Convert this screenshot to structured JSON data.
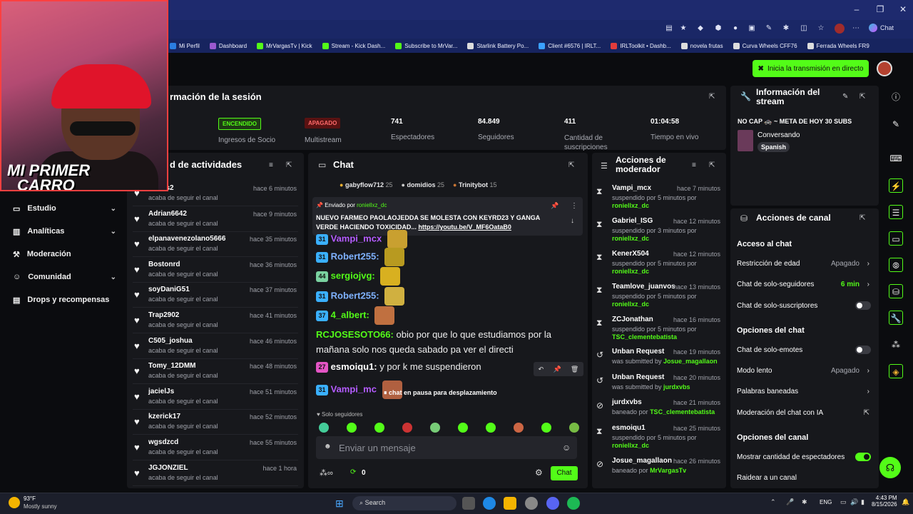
{
  "browser": {
    "bookmarks": [
      {
        "label": "Mi Perfil",
        "color": "#2a7de1"
      },
      {
        "label": "Dashboard",
        "color": "#9b59d0"
      },
      {
        "label": "MrVargasTv | Kick",
        "color": "#53fc18"
      },
      {
        "label": "Stream - Kick Dash...",
        "color": "#53fc18"
      },
      {
        "label": "Subscribe to MrVar...",
        "color": "#53fc18"
      },
      {
        "label": "Starlink Battery Po...",
        "color": "#dddddd"
      },
      {
        "label": "Client #6576 | IRLT...",
        "color": "#3aa0ff"
      },
      {
        "label": "IRLToolkit • Dashb...",
        "color": "#e23c3c"
      },
      {
        "label": "novela frutas",
        "color": "#dddddd"
      },
      {
        "label": "Curva Wheels CFF76",
        "color": "#dddddd"
      },
      {
        "label": "Ferrada Wheels FR9",
        "color": "#dddddd"
      }
    ],
    "copilot_label": "Chat"
  },
  "webcam": {
    "overlay_text_line1": "MI PRIMER",
    "overlay_text_line2": "CARRO"
  },
  "header": {
    "go_live_label": "Inicia la transmisión en directo"
  },
  "sidebar": {
    "items": [
      {
        "label": "Estudio",
        "icon": "studio-icon",
        "has_chevron": true
      },
      {
        "label": "Analíticas",
        "icon": "analytics-icon",
        "has_chevron": true
      },
      {
        "label": "Moderación",
        "icon": "moderation-icon",
        "has_chevron": false
      },
      {
        "label": "Comunidad",
        "icon": "community-icon",
        "has_chevron": true
      },
      {
        "label": "Drops y recompensas",
        "icon": "drops-icon",
        "has_chevron": false
      }
    ]
  },
  "session": {
    "title": "rmación de la sesión",
    "stats": [
      {
        "badge": "ENCENDIDO",
        "label": "Ingresos de Socio"
      },
      {
        "badge": "APAGADO",
        "label": "Multistream"
      },
      {
        "value": "741",
        "label": "Espectadores"
      },
      {
        "value": "84.849",
        "label": "Seguidores"
      },
      {
        "value": "411",
        "label": "Cantidad de suscripciones"
      },
      {
        "value": "01:04:58",
        "label": "Tiempo en vivo"
      }
    ]
  },
  "stream_info": {
    "title": "Información del stream",
    "stream_title": "NO CAP 🚓 ~ META DE HOY 30 SUBS",
    "category": "Conversando",
    "language": "Spanish"
  },
  "activity": {
    "title": "d de actividades",
    "rows": [
      {
        "name": "ramos2",
        "sub": "acaba de seguir el canal",
        "time": "hace 6 minutos"
      },
      {
        "name": "Adrian6642",
        "sub": "acaba de seguir el canal",
        "time": "hace 9 minutos"
      },
      {
        "name": "elpanavenezolano5666",
        "sub": "acaba de seguir el canal",
        "time": "hace 35 minutos"
      },
      {
        "name": "Bostonrd",
        "sub": "acaba de seguir el canal",
        "time": "hace 36 minutos"
      },
      {
        "name": "soyDaniG51",
        "sub": "acaba de seguir el canal",
        "time": "hace 37 minutos"
      },
      {
        "name": "Trap2902",
        "sub": "acaba de seguir el canal",
        "time": "hace 41 minutos"
      },
      {
        "name": "C505_joshua",
        "sub": "acaba de seguir el canal",
        "time": "hace 46 minutos"
      },
      {
        "name": "Tomy_12DMM",
        "sub": "acaba de seguir el canal",
        "time": "hace 48 minutos"
      },
      {
        "name": "jacielJs",
        "sub": "acaba de seguir el canal",
        "time": "hace 51 minutos"
      },
      {
        "name": "kzerick17",
        "sub": "acaba de seguir el canal",
        "time": "hace 52 minutos"
      },
      {
        "name": "wgsdzcd",
        "sub": "acaba de seguir el canal",
        "time": "hace 55 minutos"
      },
      {
        "name": "JGJONZIEL",
        "sub": "acaba de seguir el canal",
        "time": "hace 1 hora"
      }
    ]
  },
  "chat": {
    "title": "Chat",
    "top_gifters": [
      {
        "name": "gabyflow712",
        "count": "25"
      },
      {
        "name": "domidios",
        "count": "25"
      },
      {
        "name": "Trinitybot",
        "count": "15"
      }
    ],
    "pinned": {
      "by_prefix": "Enviado por",
      "by_user": "roniellxz_dc",
      "text": "NUEVO FARMEO PAOLAOJEDDA SE MOLESTA CON KEYRD23 Y GANGA VERDE HACIENDO TOXICIDAD...",
      "link": "https://youtu.be/V_MF6OataB0"
    },
    "messages": [
      {
        "level": "31",
        "user": "Vampi_mcx",
        "text": "",
        "color": "#b55cff"
      },
      {
        "level": "31",
        "user": "Robert255:",
        "text": "",
        "color": "#7fb2ff"
      },
      {
        "level": "44",
        "user": "sergiojvg:",
        "text": "",
        "color": "#53fc18"
      },
      {
        "level": "31",
        "user": "Robert255:",
        "text": "",
        "color": "#7fb2ff"
      },
      {
        "level": "37",
        "user": "4_albert:",
        "text": "",
        "color": "#53fc18"
      },
      {
        "level": "",
        "user": "RCJOSESOTO66:",
        "text": "obio por que lo que estudiamos por la mañana solo nos queda sabado pa ver el directi",
        "color": "#53fc18"
      },
      {
        "level": "27",
        "user": "esmoiqu1:",
        "text": "y por k me suspendieron",
        "color": "#ffffff"
      },
      {
        "level": "31",
        "user": "Vampi_mc",
        "text": "",
        "color": "#b55cff"
      }
    ],
    "paused_label": "chat en pausa para desplazamiento",
    "followers_only_label": "Solo seguidores",
    "input_placeholder": "Enviar un mensaje",
    "points": "0",
    "send_label": "Chat"
  },
  "mod_actions": {
    "title": "Acciones de moderador",
    "rows": [
      {
        "icon": "timeout-icon",
        "name": "Vampi_mcx",
        "time": "hace 7 minutos",
        "sub": "suspendido por 5 minutos por",
        "by": "roniellxz_dc"
      },
      {
        "icon": "timeout-icon",
        "name": "Gabriel_ISG",
        "time": "hace 12 minutos",
        "sub": "suspendido por 3 minutos por",
        "by": "roniellxz_dc"
      },
      {
        "icon": "timeout-icon",
        "name": "KenerX504",
        "time": "hace 12 minutos",
        "sub": "suspendido por 5 minutos por",
        "by": "roniellxz_dc"
      },
      {
        "icon": "timeout-icon",
        "name": "Teamlove_juanvos",
        "time": "hace 13 minutos",
        "sub": "suspendido por 5 minutos por",
        "by": "roniellxz_dc"
      },
      {
        "icon": "timeout-icon",
        "name": "ZCJonathan",
        "time": "hace 16 minutos",
        "sub": "suspendido por 5 minutos por",
        "by": "TSC_clementebatista"
      },
      {
        "icon": "unban-icon",
        "name": "Unban Request",
        "time": "hace 19 minutos",
        "sub": "was submitted by",
        "by": "Josue_magallaon"
      },
      {
        "icon": "unban-icon",
        "name": "Unban Request",
        "time": "hace 20 minutos",
        "sub": "was submitted by",
        "by": "jurdxvbs"
      },
      {
        "icon": "ban-icon",
        "name": "jurdxvbs",
        "time": "hace 21 minutos",
        "sub": "baneado por",
        "by": "TSC_clementebatista"
      },
      {
        "icon": "timeout-icon",
        "name": "esmoiqu1",
        "time": "hace 25 minutos",
        "sub": "suspendido por 5 minutos por",
        "by": "roniellxz_dc"
      },
      {
        "icon": "ban-icon",
        "name": "Josue_magallaon",
        "time": "hace 26 minutos",
        "sub": "baneado por",
        "by": "MrVargasTv"
      }
    ]
  },
  "channel_actions": {
    "title": "Acciones de canal",
    "chat_access_heading": "Acceso al chat",
    "chat_options_heading": "Opciones del chat",
    "channel_options_heading": "Opciones del canal",
    "rows": [
      {
        "label": "Restricción de edad",
        "value": "Apagado",
        "type": "chevron"
      },
      {
        "label": "Chat de solo-seguidores",
        "value": "6 min",
        "type": "chevron"
      },
      {
        "label": "Chat de solo-suscriptores",
        "value": "",
        "type": "toggle-off"
      },
      {
        "label": "Chat de solo-emotes",
        "value": "",
        "type": "toggle-off"
      },
      {
        "label": "Modo lento",
        "value": "Apagado",
        "type": "chevron"
      },
      {
        "label": "Palabras baneadas",
        "value": "",
        "type": "chevron"
      },
      {
        "label": "Moderación del chat con IA",
        "value": "",
        "type": "external"
      },
      {
        "label": "Mostrar cantidad de espectadores",
        "value": "",
        "type": "toggle-on"
      },
      {
        "label": "Raidear a un canal",
        "value": "",
        "type": "none"
      }
    ]
  },
  "taskbar": {
    "weather_temp": "93°F",
    "weather_desc": "Mostly sunny",
    "search_label": "Search",
    "lang": "ENG",
    "time": "4:43 PM",
    "date": "8/15/2026"
  }
}
